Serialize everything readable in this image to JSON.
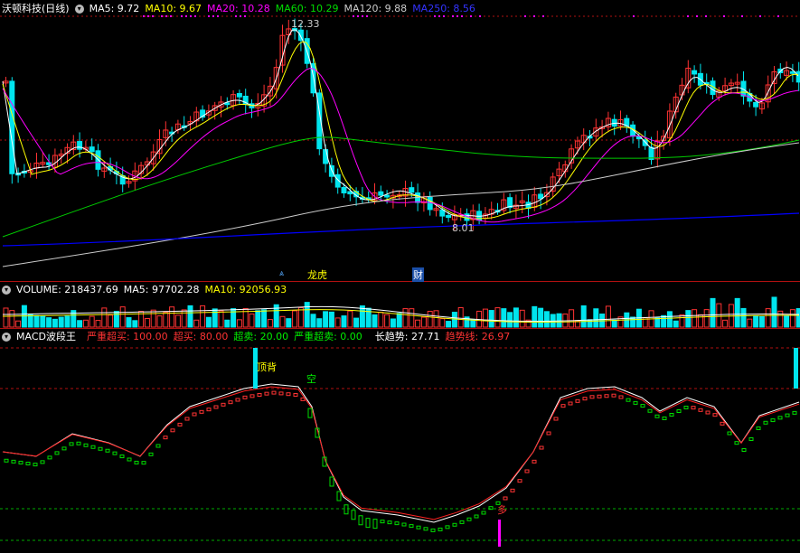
{
  "main_header": {
    "title": "沃顿科技(日线)",
    "ma5_label": "MA5: 9.72",
    "ma10_label": "MA10: 9.67",
    "ma20_label": "MA20: 10.28",
    "ma60_label": "MA60: 10.29",
    "ma120_label": "MA120: 9.88",
    "ma250_label": "MA250: 8.56"
  },
  "main_chart": {
    "high_label": "12.33",
    "low_label": "8.01",
    "event_1": "龙虎",
    "event_2": "财"
  },
  "volume_header": {
    "volume_label": "VOLUME: 218437.69",
    "ma5_label": "MA5: 97702.28",
    "ma10_label": "MA10: 92056.93"
  },
  "macd_header": {
    "title": "MACD波段王",
    "p1": "严重超买: 100.00",
    "p2": "超买: 80.00",
    "p3": "超卖: 20.00",
    "p4": "严重超卖: 0.00",
    "p5": "长趋势: 27.71",
    "p6": "趋势线: 26.97"
  },
  "macd_chart": {
    "top_label": "顶背",
    "empty_label": "空",
    "many_label": "多"
  },
  "colors": {
    "up": "#ff3333",
    "down": "#00e5ee",
    "ma5": "#ffffff",
    "ma10": "#ffff00",
    "ma20": "#ff00ff",
    "ma60": "#00cc00",
    "ma120": "#cccccc",
    "ma250": "#0000ff",
    "grid": "#b01010"
  }
}
